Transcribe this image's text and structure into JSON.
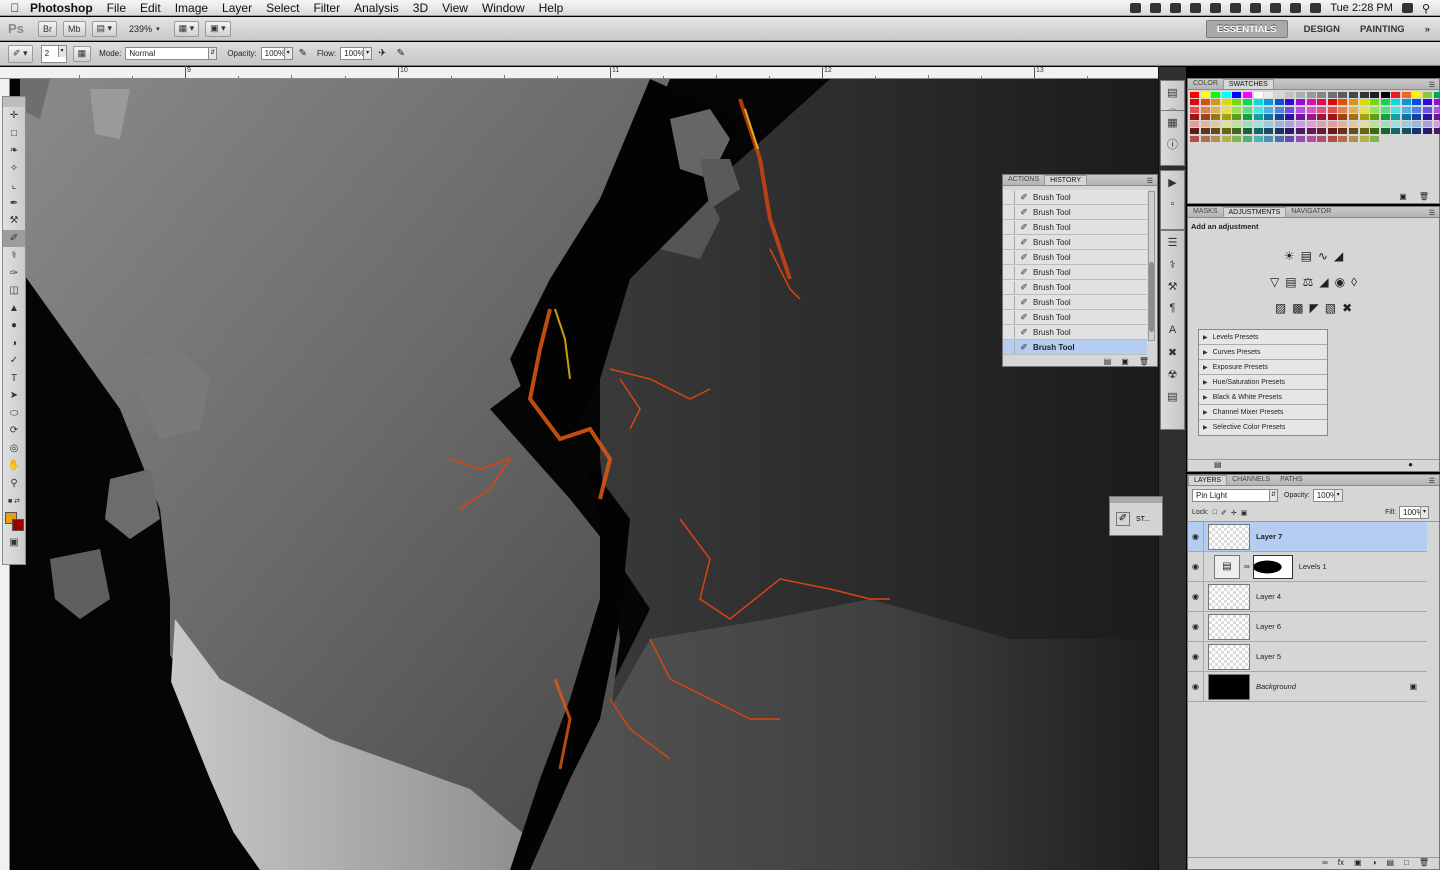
{
  "menubar": {
    "app_name": "Photoshop",
    "menus": [
      "File",
      "Edit",
      "Image",
      "Layer",
      "Select",
      "Filter",
      "Analysis",
      "3D",
      "View",
      "Window",
      "Help"
    ],
    "clock": "Tue 2:28 PM"
  },
  "appbar": {
    "logo": "Ps",
    "br_label": "Br",
    "mb_label": "Mb",
    "zoom": "239%",
    "workspaces": [
      "ESSENTIALS",
      "DESIGN",
      "PAINTING"
    ],
    "more": "»"
  },
  "options": {
    "brush_size": "2",
    "mode_label": "Mode:",
    "mode_value": "Normal",
    "opacity_label": "Opacity:",
    "opacity_value": "100%",
    "flow_label": "Flow:",
    "flow_value": "100%"
  },
  "ruler": {
    "labels": [
      "9",
      "10",
      "11",
      "12",
      "13"
    ]
  },
  "color_panel": {
    "tabs": [
      "COLOR",
      "SWATCHES"
    ],
    "active": "SWATCHES"
  },
  "history_panel": {
    "tabs": [
      "ACTIONS",
      "HISTORY"
    ],
    "active": "HISTORY",
    "items": [
      "Brush Tool",
      "Brush Tool",
      "Brush Tool",
      "Brush Tool",
      "Brush Tool",
      "Brush Tool",
      "Brush Tool",
      "Brush Tool",
      "Brush Tool",
      "Brush Tool",
      "Brush Tool"
    ],
    "selected_item": "Brush Tool"
  },
  "adjustments_panel": {
    "tabs": [
      "MASKS",
      "ADJUSTMENTS",
      "NAVIGATOR"
    ],
    "active": "ADJUSTMENTS",
    "heading": "Add an adjustment",
    "presets": [
      "Levels Presets",
      "Curves Presets",
      "Exposure Presets",
      "Hue/Saturation Presets",
      "Black & White Presets",
      "Channel Mixer Presets",
      "Selective Color Presets"
    ]
  },
  "layers_panel": {
    "tabs": [
      "LAYERS",
      "CHANNELS",
      "PATHS"
    ],
    "active": "LAYERS",
    "blend_mode": "Pin Light",
    "opacity_label": "Opacity:",
    "opacity_value": "100%",
    "lock_label": "Lock:",
    "fill_label": "Fill:",
    "fill_value": "100%",
    "layers": [
      "Layer 7",
      "Levels 1",
      "Layer 4",
      "Layer 6",
      "Layer 5",
      "Background"
    ]
  },
  "mini_panel": {
    "label": "ST..."
  },
  "colors": {
    "foreground": "#e8a010",
    "background": "#9a0000",
    "selection": "#b5cdf1"
  }
}
